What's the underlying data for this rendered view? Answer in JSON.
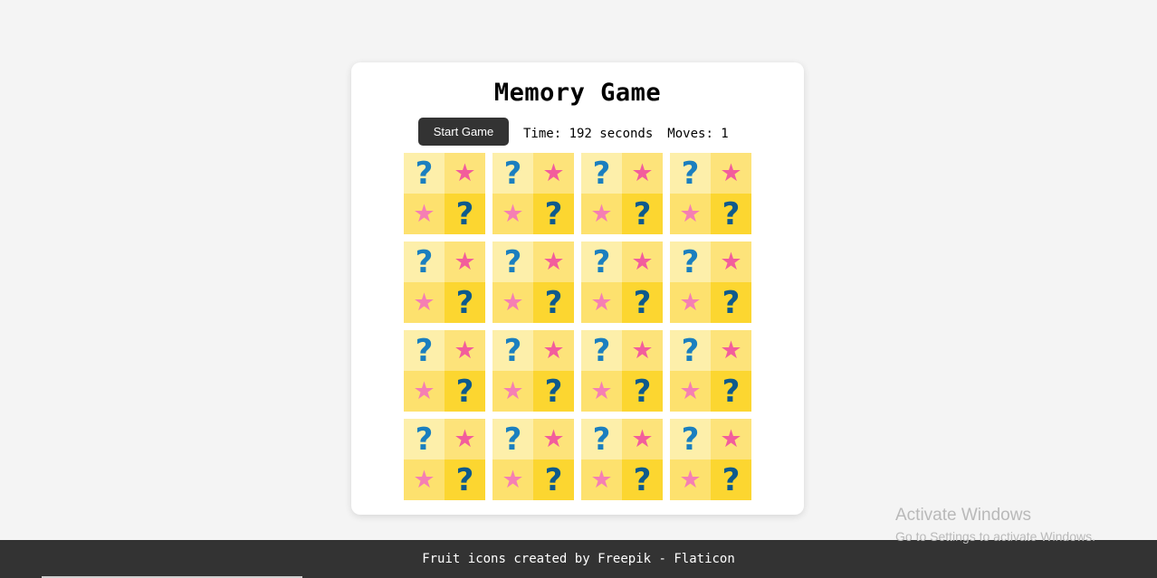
{
  "game": {
    "title": "Memory Game",
    "start_button_label": "Start Game",
    "time_text": "Time: 192 seconds",
    "moves_text": "Moves: 1"
  },
  "board": {
    "rows": 4,
    "columns": 4,
    "tiles_state": "face-down",
    "tile_back_icons": [
      "question-mark-icon",
      "star-icon",
      "star-icon",
      "question-mark-icon"
    ],
    "question_glyph": "?",
    "star_glyph": "★",
    "colors": {
      "quadrant_light": "#fdefaa",
      "quadrant_mid": "#fde37a",
      "quadrant_mid2": "#fde16e",
      "quadrant_dark": "#fcd630",
      "question_light": "#1b7fbf",
      "question_dark": "#0e5a8c",
      "star_pink": "#f25d9c",
      "star_pink_light": "#f57fb3"
    }
  },
  "footer": {
    "credit_text": "Fruit icons created by Freepik - Flaticon",
    "background": "#333333"
  },
  "os_watermark": {
    "title": "Activate Windows",
    "subtitle": "Go to Settings to activate Windows."
  }
}
